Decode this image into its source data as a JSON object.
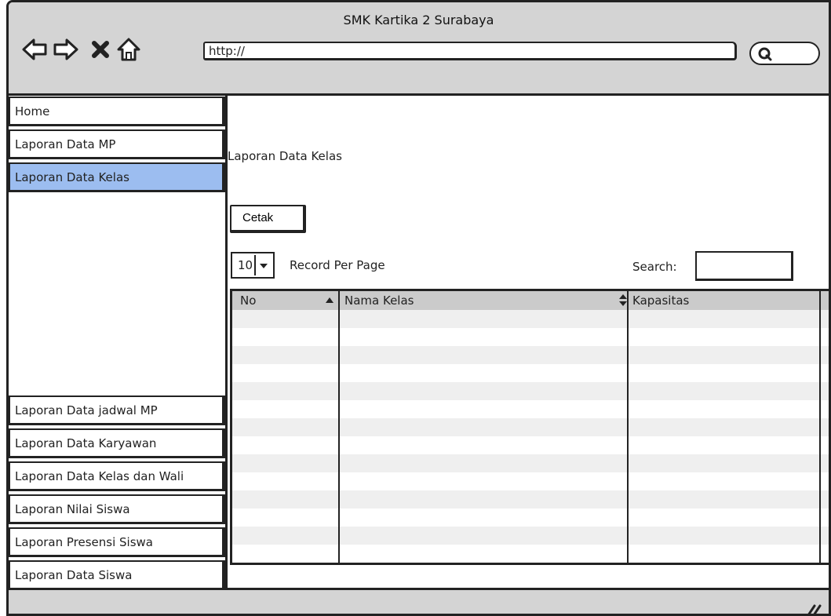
{
  "window": {
    "title": "SMK Kartika 2 Surabaya"
  },
  "toolbar": {
    "back": "back-arrow-icon",
    "forward": "forward-arrow-icon",
    "stop": "close-icon",
    "home": "home-icon",
    "url": "http://",
    "search": "search-icon"
  },
  "sidebar": {
    "items": [
      {
        "label": "Home"
      },
      {
        "label": "Laporan Data MP"
      },
      {
        "label": "Laporan Data Kelas",
        "active": true
      },
      {
        "label": "Laporan Data jadwal MP"
      },
      {
        "label": "Laporan Data Karyawan"
      },
      {
        "label": "Laporan Data Kelas dan Wali"
      },
      {
        "label": "Laporan Nilai Siswa"
      },
      {
        "label": "Laporan Presensi Siswa"
      },
      {
        "label": "Laporan Data Siswa"
      }
    ],
    "active_color": "#9cbdf0"
  },
  "main": {
    "heading": "Laporan Data Kelas",
    "print_button": "Cetak",
    "per_page": {
      "value": "10",
      "label": "Record Per Page"
    },
    "search_label": "Search:",
    "table": {
      "columns": [
        {
          "label": "No",
          "sort": "ascending"
        },
        {
          "label": "Nama Kelas",
          "sort": "both"
        },
        {
          "label": "Kapasitas"
        }
      ],
      "header_color": "#cbcbcb",
      "stripe_color": "#efefef"
    }
  }
}
